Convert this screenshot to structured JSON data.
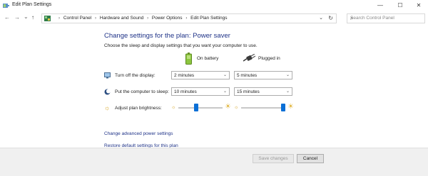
{
  "window": {
    "title": "Edit Plan Settings",
    "controls": {
      "minimize": "—",
      "maximize": "☐",
      "close": "✕"
    }
  },
  "nav": {
    "back": "←",
    "forward": "→",
    "recent": "⌄",
    "up": "↑"
  },
  "address": {
    "breadcrumbs": [
      "Control Panel",
      "Hardware and Sound",
      "Power Options",
      "Edit Plan Settings"
    ],
    "separator": "›",
    "dropdown": "⌄",
    "refresh": "↻"
  },
  "search": {
    "placeholder": "Search Control Panel",
    "icon": "⌕"
  },
  "main": {
    "title": "Change settings for the plan: Power saver",
    "subtitle": "Choose the sleep and display settings that you want your computer to use.",
    "columns": {
      "battery": "On battery",
      "plugged": "Plugged in"
    },
    "settings": {
      "display": {
        "label": "Turn off the display:",
        "battery": "2 minutes",
        "plugged": "5 minutes"
      },
      "sleep": {
        "label": "Put the computer to sleep:",
        "battery": "10 minutes",
        "plugged": "15 minutes"
      },
      "brightness": {
        "label": "Adjust plan brightness:",
        "battery_level": 0.4,
        "plugged_level": 1.0
      }
    },
    "links": {
      "advanced": "Change advanced power settings",
      "restore": "Restore default settings for this plan"
    }
  },
  "footer": {
    "save": "Save changes",
    "cancel": "Cancel"
  },
  "colors": {
    "accent": "#1e3287",
    "slider_thumb": "#0a6fd6"
  },
  "icons": {
    "battery": "battery-icon",
    "plug": "plug-icon",
    "display": "monitor-icon",
    "sleep": "moon-icon",
    "brightness": "sun-icon"
  }
}
